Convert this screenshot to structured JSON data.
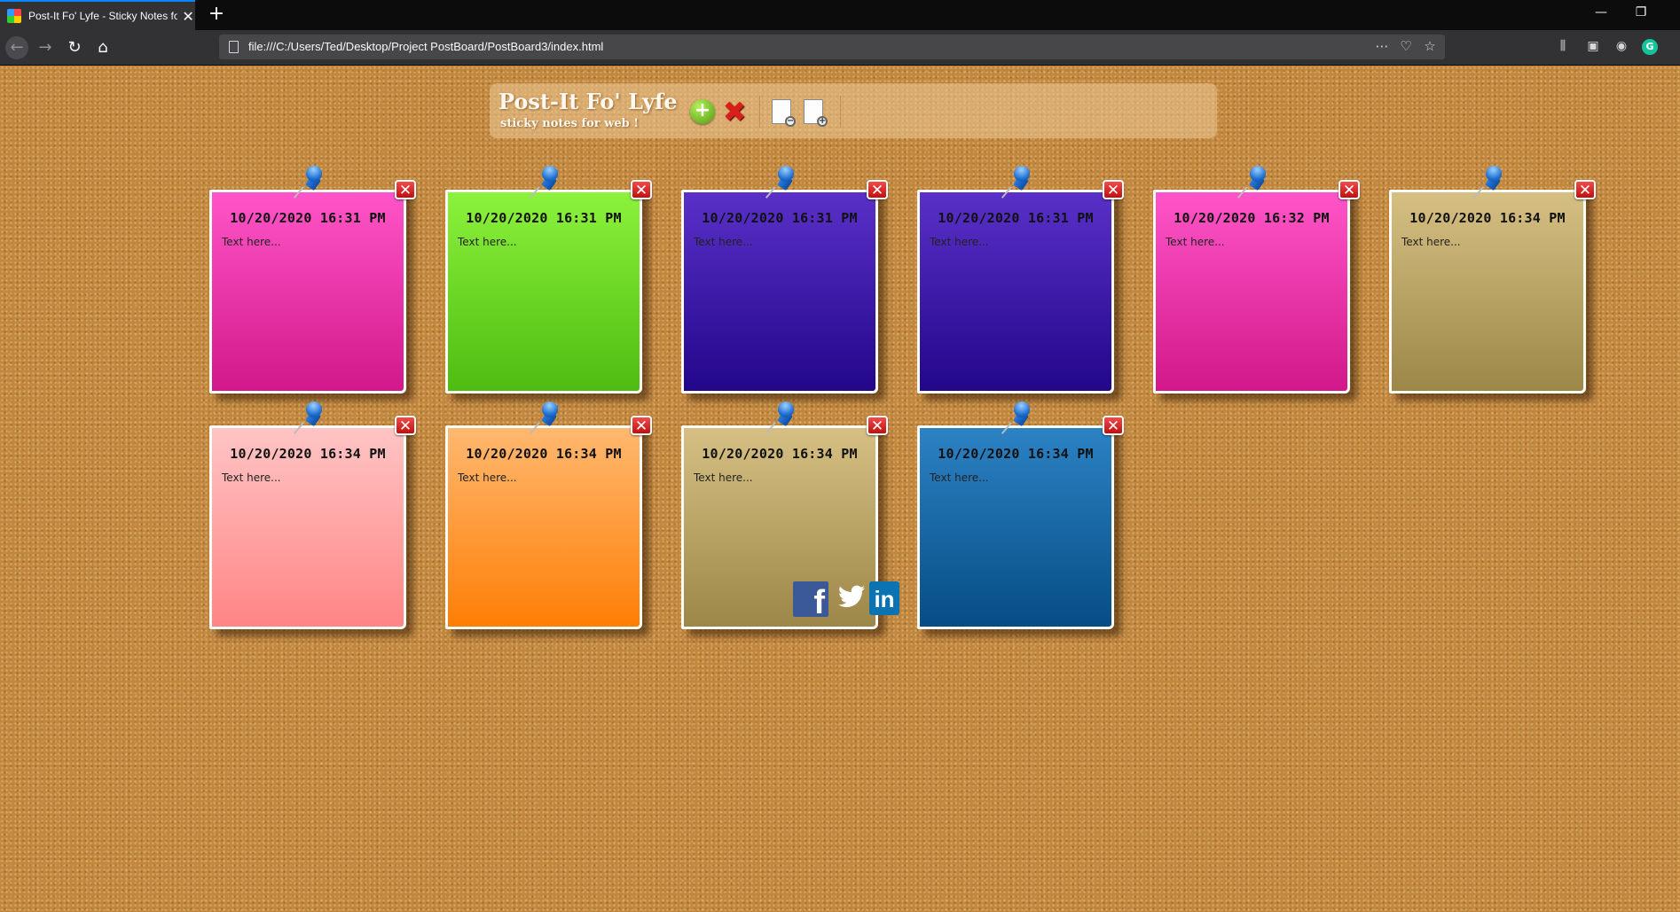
{
  "browser": {
    "tab_title": "Post-It Fo' Lyfe - Sticky Notes for Web",
    "tab_close": "✕",
    "new_tab": "+",
    "url": "file:///C:/Users/Ted/Desktop/Project PostBoard/PostBoard3/index.html",
    "icons": [
      "back-icon",
      "forward-icon",
      "reload-icon",
      "home-icon",
      "page-icon",
      "more-icon",
      "pocket-icon",
      "bookmark-star-icon",
      "library-icon",
      "sidebar-icon",
      "account-icon",
      "grammarly-icon"
    ],
    "grammarly_label": "G"
  },
  "header": {
    "title": "Post-It Fo' Lyfe",
    "subtitle": "sticky notes for web !"
  },
  "notes": [
    {
      "date": "10/20/2020 16:31 PM",
      "text": "Text here...",
      "color_top": "#ff55c8",
      "color_bottom": "#d2188a"
    },
    {
      "date": "10/20/2020 16:31 PM",
      "text": "Text here...",
      "color_top": "#8cf23c",
      "color_bottom": "#4ebc10"
    },
    {
      "date": "10/20/2020 16:31 PM",
      "text": "Text here...",
      "color_top": "#5a30c8",
      "color_bottom": "#22078a"
    },
    {
      "date": "10/20/2020 16:31 PM",
      "text": "Text here...",
      "color_top": "#5a30c8",
      "color_bottom": "#22078a"
    },
    {
      "date": "10/20/2020 16:32 PM",
      "text": "Text here...",
      "color_top": "#ff55c8",
      "color_bottom": "#d2188a"
    },
    {
      "date": "10/20/2020 16:34 PM",
      "text": "Text here...",
      "color_top": "#d6bf82",
      "color_bottom": "#9c8748"
    },
    {
      "date": "10/20/2020 16:34 PM",
      "text": "Text here...",
      "color_top": "#ffc4c4",
      "color_bottom": "#ff8585"
    },
    {
      "date": "10/20/2020 16:34 PM",
      "text": "Text here...",
      "color_top": "#ffb870",
      "color_bottom": "#ff7e05"
    },
    {
      "date": "10/20/2020 16:34 PM",
      "text": "Text here...",
      "color_top": "#d6bf82",
      "color_bottom": "#9c8748"
    },
    {
      "date": "10/20/2020 16:34 PM",
      "text": "Text here...",
      "color_top": "#2c82c4",
      "color_bottom": "#064d84"
    }
  ],
  "social": {
    "facebook_glyph": "f",
    "twitter_glyph": "🐦",
    "linkedin_glyph": "in"
  }
}
